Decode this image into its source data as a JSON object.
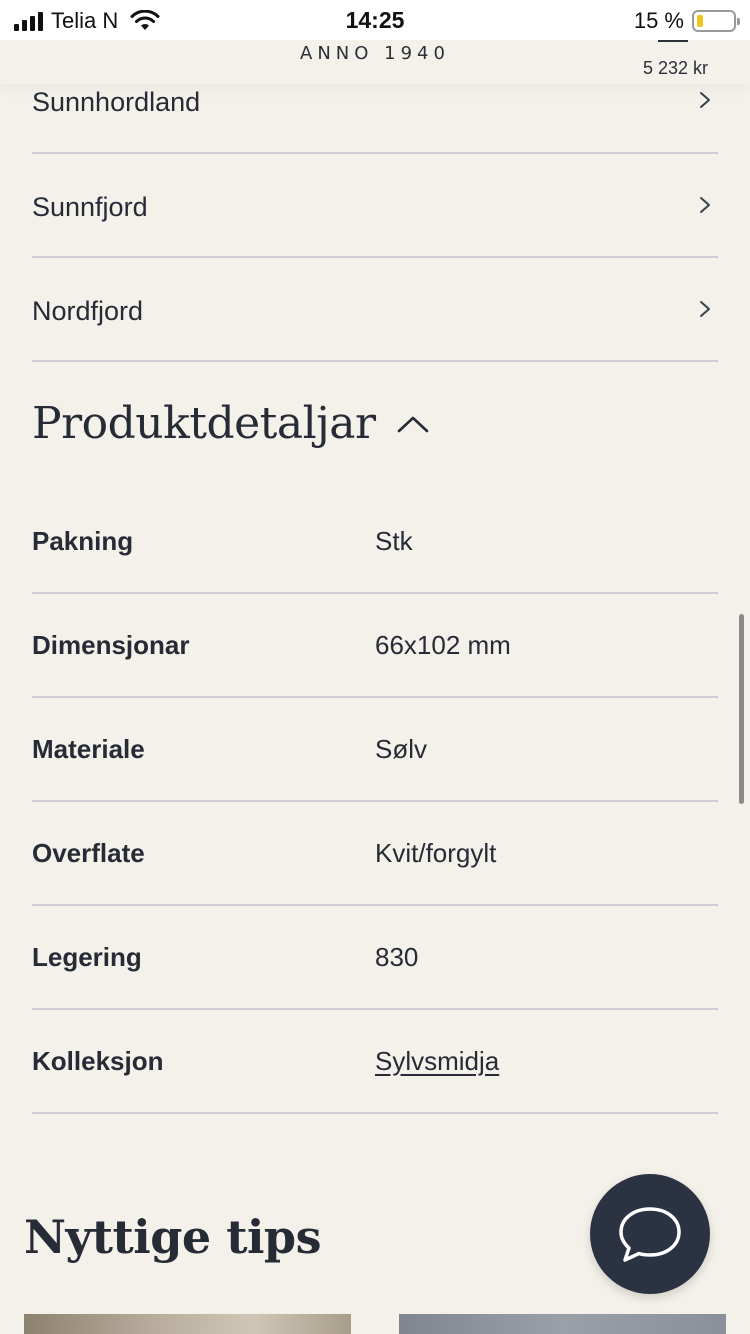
{
  "status_bar": {
    "carrier": "Telia N",
    "time": "14:25",
    "battery_text": "15 %",
    "battery_level_percent": 15
  },
  "header": {
    "brand_subtitle": "ANNO 1940",
    "cart_total": "5 232 kr"
  },
  "regions": [
    {
      "label": "Sunnhordland"
    },
    {
      "label": "Sunnfjord"
    },
    {
      "label": "Nordfjord"
    }
  ],
  "product_details": {
    "title": "Produktdetaljar",
    "expanded": true,
    "rows": [
      {
        "key": "Pakning",
        "value": "Stk"
      },
      {
        "key": "Dimensjonar",
        "value": "66x102 mm"
      },
      {
        "key": "Materiale",
        "value": "Sølv"
      },
      {
        "key": "Overflate",
        "value": "Kvit/forgylt"
      },
      {
        "key": "Legering",
        "value": "830"
      },
      {
        "key": "Kolleksjon",
        "value": "Sylvsmidja"
      }
    ]
  },
  "tips": {
    "title": "Nyttige tips"
  },
  "colors": {
    "background": "#f4f1ea",
    "text": "#262b35",
    "divider": "#cfcfd6",
    "chat_button": "#2b3343",
    "battery_fill": "#f0c51b"
  },
  "icons": {
    "region_chevron": "chevron-right-icon",
    "details_toggle": "chevron-up-icon",
    "chat": "chat-bubble-icon"
  }
}
